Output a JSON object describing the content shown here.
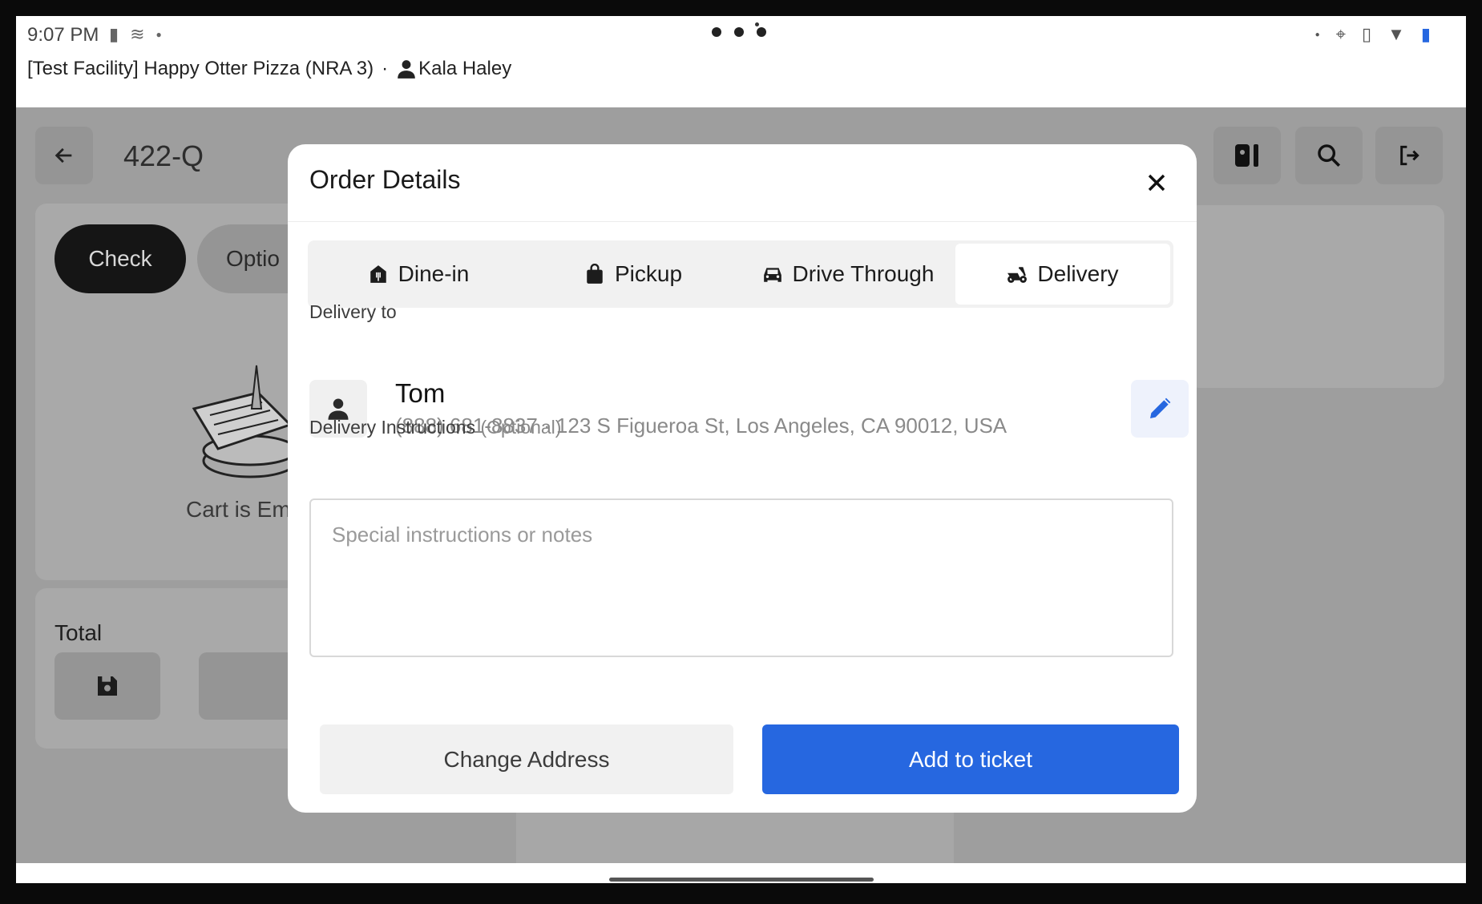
{
  "status_bar": {
    "time": "9:07 PM",
    "facility": "[Test Facility] Happy Otter Pizza (NRA 3)",
    "separator": "·",
    "user": "Kala Haley"
  },
  "background": {
    "ticket_number": "422-Q",
    "tabs": [
      "Check",
      "Optio"
    ],
    "cart_empty": "Cart is Em",
    "total_label": "Total"
  },
  "modal": {
    "title": "Order Details",
    "order_types": [
      {
        "label": "Dine-in",
        "icon": "dine-in-icon",
        "active": false
      },
      {
        "label": "Pickup",
        "icon": "shopping-bag-icon",
        "active": false
      },
      {
        "label": "Drive Through",
        "icon": "car-icon",
        "active": false
      },
      {
        "label": "Delivery",
        "icon": "scooter-icon",
        "active": true
      }
    ],
    "delivery_to_label": "Delivery to",
    "customer": {
      "name": "Tom",
      "details": "(888) 681-8837 · 123 S Figueroa St, Los Angeles, CA 90012, USA"
    },
    "instructions_label": "Delivery Instructions",
    "instructions_optional": "(Optional)",
    "instructions_placeholder": "Special instructions or notes",
    "instructions_value": "",
    "change_address_label": "Change Address",
    "add_to_ticket_label": "Add to ticket"
  },
  "colors": {
    "primary": "#2667e0",
    "overlay": "#9e9e9e",
    "edit_icon": "#2667e0"
  }
}
